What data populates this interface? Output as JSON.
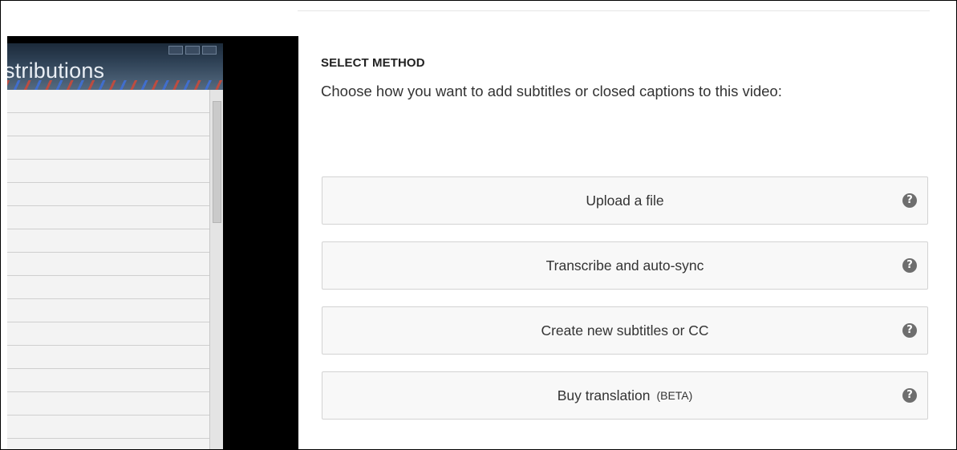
{
  "video_preview": {
    "window_title_fragment": "stributions"
  },
  "select_method": {
    "heading": "SELECT METHOD",
    "description": "Choose how you want to add subtitles or closed captions to this video:",
    "options": [
      {
        "label": "Upload a file",
        "badge": "",
        "help_icon": "?"
      },
      {
        "label": "Transcribe and auto-sync",
        "badge": "",
        "help_icon": "?"
      },
      {
        "label": "Create new subtitles or CC",
        "badge": "",
        "help_icon": "?"
      },
      {
        "label": "Buy translation",
        "badge": "(BETA)",
        "help_icon": "?"
      }
    ]
  },
  "colors": {
    "button_bg": "#f8f8f8",
    "button_border": "#d3d3d3",
    "help_icon_bg": "#6e6e6e",
    "video_bg": "#000000"
  },
  "icons": {
    "help": "question-circle-icon",
    "window_controls": "window-controls-icon"
  }
}
